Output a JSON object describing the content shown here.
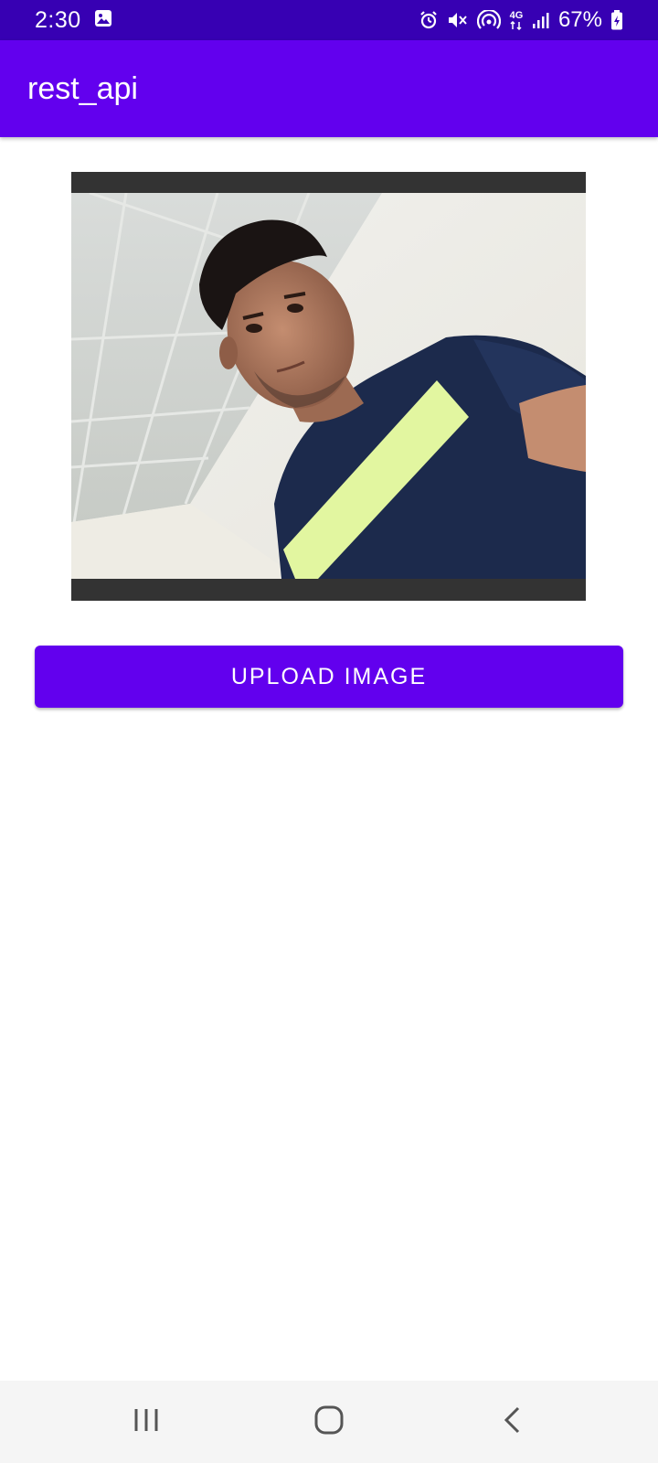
{
  "status_bar": {
    "time": "2:30",
    "network_type": "4G",
    "battery_percent": "67%",
    "icons": [
      "gallery-icon",
      "alarm-icon",
      "mute-icon",
      "hotspot-icon",
      "network-4g-icon",
      "signal-icon",
      "battery-icon"
    ]
  },
  "app_bar": {
    "title": "rest_api"
  },
  "main": {
    "image_description": "selected photo preview",
    "upload_button_label": "UPLOAD IMAGE"
  },
  "nav_bar": {
    "icons": [
      "recents-icon",
      "home-icon",
      "back-icon"
    ]
  },
  "colors": {
    "status_bar": "#3700b3",
    "primary": "#6200ee",
    "image_frame": "#333333",
    "nav_bar": "#f5f5f5"
  }
}
